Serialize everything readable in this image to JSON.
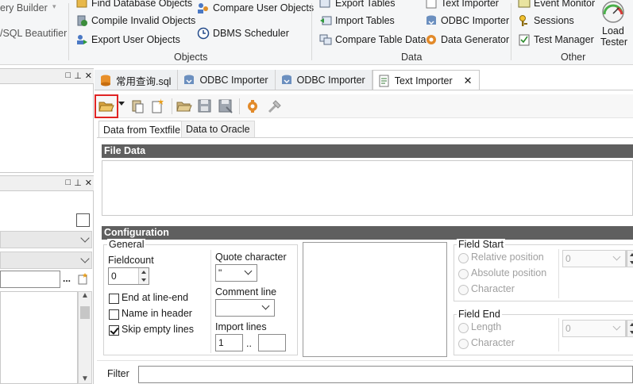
{
  "ribbon": {
    "left_items": [
      "ery Builder",
      "/SQL Beautifier"
    ],
    "objects_group": {
      "label": "Objects",
      "items": [
        "Find Database Objects",
        "Compile Invalid Objects",
        "Export User Objects",
        "Compare User Objects",
        "DBMS Scheduler"
      ]
    },
    "data_group": {
      "label": "Data",
      "items": [
        "Export Tables",
        "Import Tables",
        "Compare Table Data",
        "Text Importer",
        "ODBC Importer",
        "Data Generator"
      ]
    },
    "other_group": {
      "label": "Other",
      "items": [
        "Event Monitor",
        "Sessions",
        "Test Manager"
      ],
      "load_tester": [
        "Load",
        "Tester"
      ]
    }
  },
  "panel_buttons": [
    "□",
    "⊥",
    "✕"
  ],
  "doc_tabs": [
    "常用查询.sql",
    "ODBC Importer",
    "ODBC Importer",
    "Text Importer"
  ],
  "close_glyph": "✕",
  "sub_tabs": [
    "Data from Textfile",
    "Data to Oracle"
  ],
  "sections": {
    "file_data": "File Data",
    "configuration": "Configuration"
  },
  "general": {
    "title": "General",
    "fieldcount_label": "Fieldcount",
    "fieldcount_value": "0",
    "end_at_line_end": "End at line-end",
    "name_in_header": "Name in header",
    "skip_empty_lines": "Skip empty lines",
    "skip_empty_checked": true,
    "quote_character_label": "Quote character",
    "quote_character_value": "\"",
    "comment_line_label": "Comment line",
    "comment_line_value": "",
    "import_lines_label": "Import lines",
    "import_from": "1",
    "import_sep": "..",
    "import_to": ""
  },
  "field_start": {
    "title": "Field Start",
    "options": [
      "Relative position",
      "Absolute position",
      "Character"
    ],
    "value": "0"
  },
  "field_end": {
    "title": "Field End",
    "options": [
      "Length",
      "Character"
    ],
    "value": "0"
  },
  "filter_label": "Filter",
  "left_panel": {
    "dots": "..."
  },
  "icons": [
    "open-file-icon",
    "dropdown-arrow-icon",
    "paste-icon",
    "new-icon",
    "folder-icon",
    "save-icon",
    "save-as-icon",
    "settings-icon",
    "tool-icon"
  ]
}
